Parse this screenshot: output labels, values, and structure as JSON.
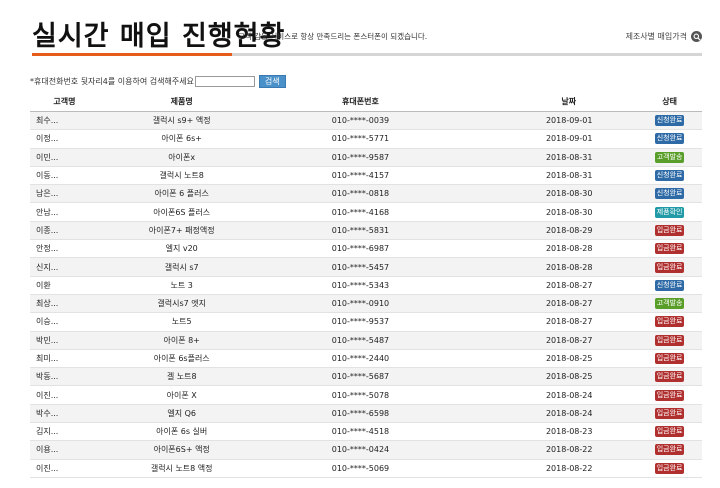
{
  "header": {
    "title": "실시간 매입 진행현황",
    "subtitle": "고객 감동 서비스로 항상 만족드리는 폰스터폰이 되겠습니다.",
    "top_link": "제조사별 매입가격",
    "accent_color": "#e85c1a"
  },
  "search": {
    "label": "*휴대전화번호 뒷자리4를 이용하여 검색해주세요",
    "input_value": "",
    "button": "검색"
  },
  "table": {
    "headers": [
      "고객명",
      "제품명",
      "휴대폰번호",
      "날짜",
      "상태"
    ],
    "rows": [
      {
        "name": "최수...",
        "product": "갤럭시 s9+ 액정",
        "phone": "010-****-0039",
        "date": "2018-09-01",
        "status": "신청완료",
        "status_color": "#2d6aa6"
      },
      {
        "name": "이정...",
        "product": "아이폰 6s+",
        "phone": "010-****-5771",
        "date": "2018-09-01",
        "status": "신청완료",
        "status_color": "#2d6aa6"
      },
      {
        "name": "이민...",
        "product": "아이폰x",
        "phone": "010-****-9587",
        "date": "2018-08-31",
        "status": "고객발송",
        "status_color": "#5a9e2a"
      },
      {
        "name": "이동...",
        "product": "갤럭시 노트8",
        "phone": "010-****-4157",
        "date": "2018-08-31",
        "status": "신청완료",
        "status_color": "#2d6aa6"
      },
      {
        "name": "남은...",
        "product": "아이폰 6 플러스",
        "phone": "010-****-0818",
        "date": "2018-08-30",
        "status": "신청완료",
        "status_color": "#2d6aa6"
      },
      {
        "name": "안남...",
        "product": "아이폰6S 플러스",
        "phone": "010-****-4168",
        "date": "2018-08-30",
        "status": "제품확인",
        "status_color": "#1f9aa6"
      },
      {
        "name": "이종...",
        "product": "아이폰7+ 패정액정",
        "phone": "010-****-5831",
        "date": "2018-08-29",
        "status": "입금완료",
        "status_color": "#b03030"
      },
      {
        "name": "안정...",
        "product": "엘지 v20",
        "phone": "010-****-6987",
        "date": "2018-08-28",
        "status": "입금완료",
        "status_color": "#b03030"
      },
      {
        "name": "신지...",
        "product": "갤럭시 s7",
        "phone": "010-****-5457",
        "date": "2018-08-28",
        "status": "입금완료",
        "status_color": "#b03030"
      },
      {
        "name": "이환",
        "product": "노트 3",
        "phone": "010-****-5343",
        "date": "2018-08-27",
        "status": "신청완료",
        "status_color": "#2d6aa6"
      },
      {
        "name": "최상...",
        "product": "갤럭시s7 엣지",
        "phone": "010-****-0910",
        "date": "2018-08-27",
        "status": "고객발송",
        "status_color": "#5a9e2a"
      },
      {
        "name": "이승...",
        "product": "노트5",
        "phone": "010-****-9537",
        "date": "2018-08-27",
        "status": "입금완료",
        "status_color": "#b03030"
      },
      {
        "name": "박민...",
        "product": "아이폰 8+",
        "phone": "010-****-5487",
        "date": "2018-08-27",
        "status": "입금완료",
        "status_color": "#b03030"
      },
      {
        "name": "최미...",
        "product": "아이폰 6s플러스",
        "phone": "010-****-2440",
        "date": "2018-08-25",
        "status": "입금완료",
        "status_color": "#b03030"
      },
      {
        "name": "박동...",
        "product": "겔 노트8",
        "phone": "010-****-5687",
        "date": "2018-08-25",
        "status": "입금완료",
        "status_color": "#b03030"
      },
      {
        "name": "이진...",
        "product": "아이폰 X",
        "phone": "010-****-5078",
        "date": "2018-08-24",
        "status": "입금완료",
        "status_color": "#b03030"
      },
      {
        "name": "박수...",
        "product": "엘지 Q6",
        "phone": "010-****-6598",
        "date": "2018-08-24",
        "status": "입금완료",
        "status_color": "#b03030"
      },
      {
        "name": "김지...",
        "product": "아이폰 6s 실버",
        "phone": "010-****-4518",
        "date": "2018-08-23",
        "status": "입금완료",
        "status_color": "#b03030"
      },
      {
        "name": "이용...",
        "product": "아이폰6S+ 액정",
        "phone": "010-****-0424",
        "date": "2018-08-22",
        "status": "입금완료",
        "status_color": "#b03030"
      },
      {
        "name": "이진...",
        "product": "갤럭시 노트8 액정",
        "phone": "010-****-5069",
        "date": "2018-08-22",
        "status": "입금완료",
        "status_color": "#b03030"
      }
    ]
  }
}
